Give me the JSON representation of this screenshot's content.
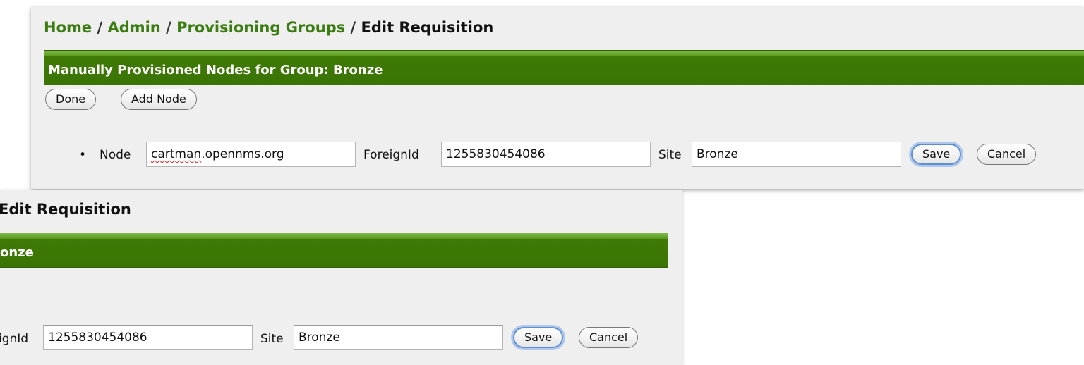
{
  "breadcrumb": {
    "home": "Home",
    "admin": "Admin",
    "groups": "Provisioning Groups",
    "current": "Edit Requisition",
    "separator": "/"
  },
  "header": {
    "title": "Manually Provisioned Nodes for Group: Bronze",
    "cropped_title": "onze"
  },
  "toolbar": {
    "done_label": "Done",
    "add_node_label": "Add Node"
  },
  "node_row": {
    "bullet": "•",
    "node_label": "Node",
    "node_value_misspelled": "cartman",
    "node_value_rest": ".opennms.org",
    "foreign_id_label": "ForeignId",
    "foreign_id_cropped_label": "ignId",
    "foreign_id_value": "1255830454086",
    "site_label": "Site",
    "site_value": "Bronze",
    "save_label": "Save",
    "cancel_label": "Cancel"
  },
  "colors": {
    "link_green": "#3b7d12",
    "header_green": "#3a7404",
    "focus_blue": "#5b8fd1"
  }
}
